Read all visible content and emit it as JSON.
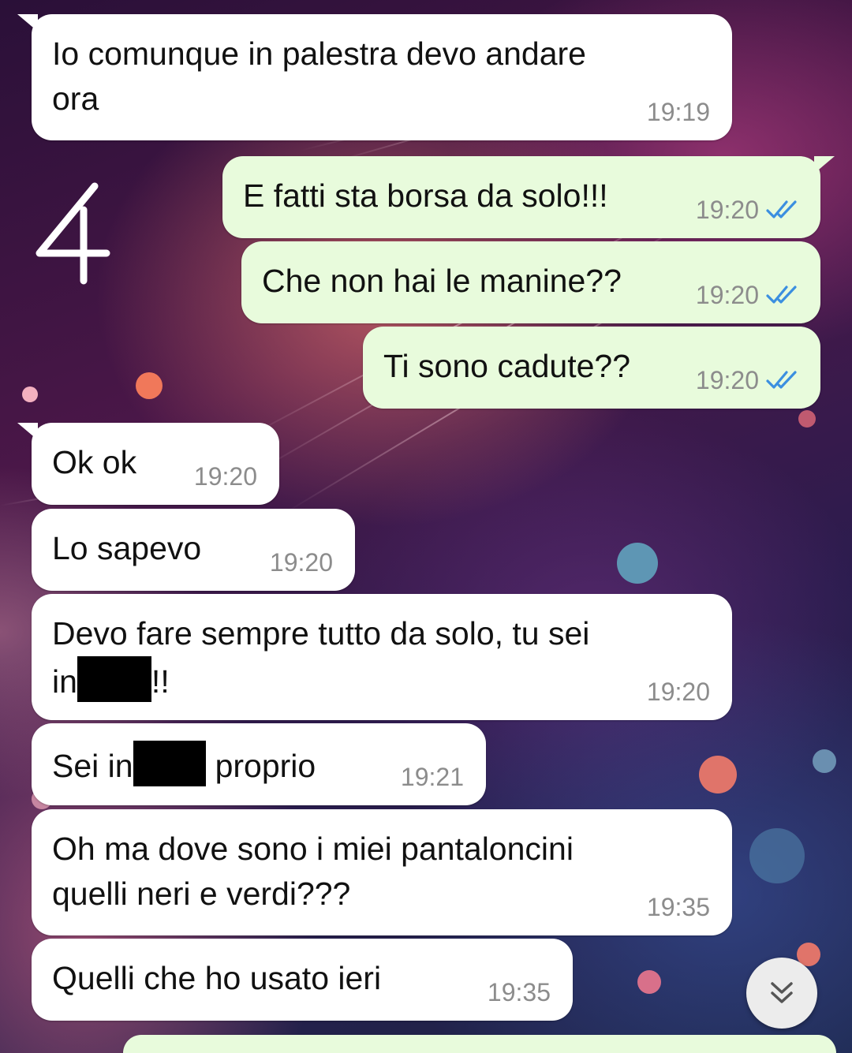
{
  "chat": {
    "messages": [
      {
        "direction": "incoming",
        "lines": [
          "Io comunque in palestra devo andare",
          "ora"
        ],
        "time": "19:19"
      },
      {
        "direction": "outgoing",
        "lines": [
          "E fatti sta borsa da solo!!!"
        ],
        "time": "19:20",
        "status": "read"
      },
      {
        "direction": "outgoing",
        "lines": [
          "Che non hai le manine??"
        ],
        "time": "19:20",
        "status": "read"
      },
      {
        "direction": "outgoing",
        "lines": [
          "Ti sono cadute??"
        ],
        "time": "19:20",
        "status": "read"
      },
      {
        "direction": "incoming",
        "lines": [
          "Ok ok"
        ],
        "time": "19:20"
      },
      {
        "direction": "incoming",
        "lines": [
          "Lo sapevo"
        ],
        "time": "19:20"
      },
      {
        "direction": "incoming",
        "lines": [
          "Devo fare sempre tutto da solo, tu sei",
          "in",
          "!!"
        ],
        "time": "19:20",
        "redacted": true
      },
      {
        "direction": "incoming",
        "lines": [
          "Sei in",
          "proprio"
        ],
        "time": "19:21",
        "redacted": true
      },
      {
        "direction": "incoming",
        "lines": [
          "Oh ma dove sono i miei pantaloncini",
          "quelli neri e verdi???"
        ],
        "time": "19:35"
      },
      {
        "direction": "incoming",
        "lines": [
          "Quelli che ho usato ieri"
        ],
        "time": "19:35"
      }
    ]
  },
  "sticker": {
    "text": "4",
    "icon": "handwritten-four-doodle"
  },
  "scroll_button": {
    "icon": "double-chevron-down-icon"
  },
  "colors": {
    "incoming_bubble": "#ffffff",
    "outgoing_bubble": "#e8fbdc",
    "timestamp": "#8c8c8c",
    "read_ticks": "#3b8fe0",
    "redaction": "#000000"
  }
}
